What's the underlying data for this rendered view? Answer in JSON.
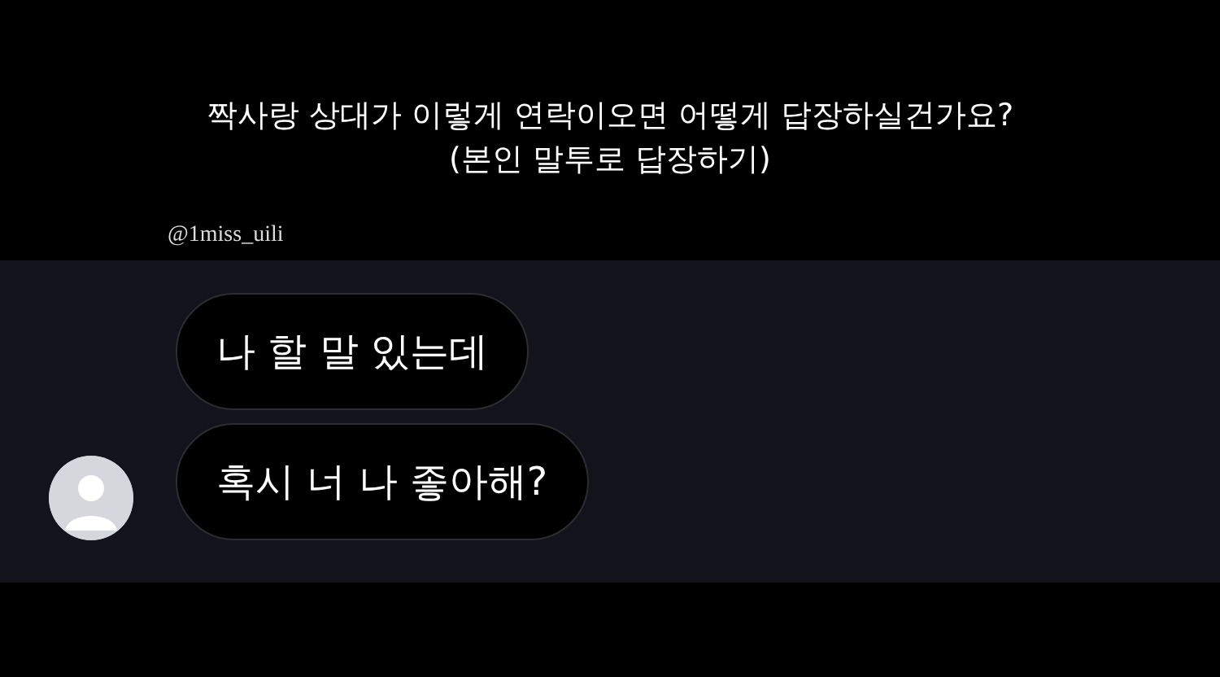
{
  "caption": {
    "lines": [
      "짝사랑 상대가 이렇게 연락이오면 어떻게 답장하실건가요?",
      "(본인 말투로 답장하기)"
    ],
    "handle": "@1miss_uili"
  },
  "messages": [
    {
      "text": "나 할 말 있는데",
      "show_avatar": false
    },
    {
      "text": "혹시 너 나 좋아해?",
      "show_avatar": true
    }
  ]
}
